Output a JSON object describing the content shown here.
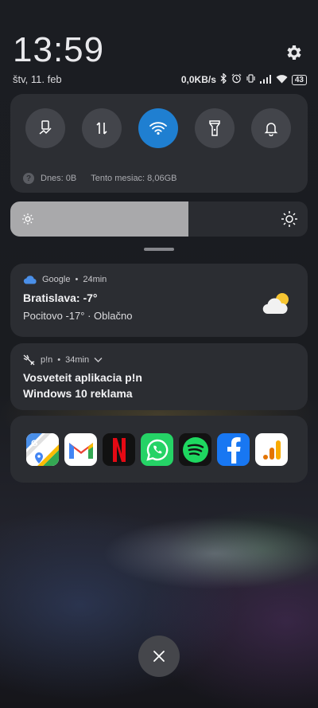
{
  "lockscreen": {
    "time": "13:59",
    "date": "štv, 11. feb"
  },
  "status_bar": {
    "net_speed": "0,0KB/s",
    "battery": "43",
    "icons": [
      "bluetooth-icon",
      "alarm-icon",
      "vibrate-icon",
      "signal-icon",
      "wifi-icon",
      "battery-icon"
    ]
  },
  "quick_settings": {
    "toggles": [
      {
        "name": "screenshot-toggle",
        "icon": "scissors-icon",
        "active": false
      },
      {
        "name": "mobile-data-toggle",
        "icon": "data-arrows-icon",
        "active": false
      },
      {
        "name": "wifi-toggle",
        "icon": "wifi-icon",
        "active": true
      },
      {
        "name": "flashlight-toggle",
        "icon": "flashlight-icon",
        "active": false
      },
      {
        "name": "notifications-toggle",
        "icon": "bell-icon",
        "active": false
      }
    ],
    "data_usage": {
      "today": "Dnes: 0B",
      "month": "Tento mesiac: 8,06GB"
    }
  },
  "brightness": {
    "level": 0.6
  },
  "notifications": [
    {
      "app": "Google",
      "time": "24min",
      "title": "Bratislava: -7°",
      "body": "Pocitovo -17° · Oblačno"
    },
    {
      "app": "p!n",
      "time": "34min",
      "title": "Vosveteit aplikacia p!n",
      "body": "Windows 10 reklama"
    }
  ],
  "app_shortcuts": [
    "Google Maps",
    "Gmail",
    "Netflix",
    "WhatsApp",
    "Spotify",
    "Facebook",
    "Google Analytics"
  ],
  "colors": {
    "accent": "#1f7fd1",
    "panel": "#2c2e33"
  }
}
